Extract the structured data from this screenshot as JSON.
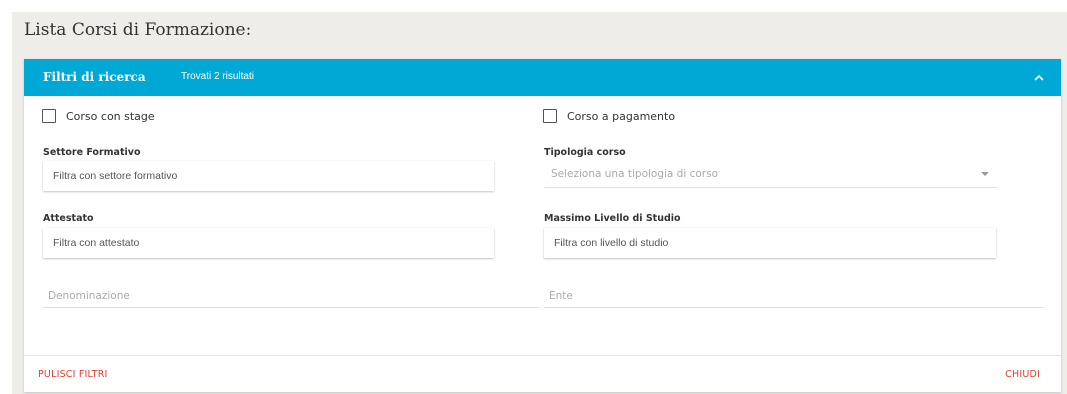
{
  "page": {
    "title": "Lista Corsi di Formazione:"
  },
  "panel": {
    "title": "Filtri di ricerca",
    "results": "Trovati 2 risultati",
    "collapse_icon": "chevron-up-icon",
    "colors": {
      "header_bg": "#00a8d6",
      "action": "#e03e2d"
    }
  },
  "filters": {
    "stage_checkbox": {
      "label": "Corso con stage",
      "checked": false
    },
    "payment_checkbox": {
      "label": "Corso a pagamento",
      "checked": false
    },
    "settore": {
      "label": "Settore Formativo",
      "placeholder": "Filtra con settore formativo",
      "value": ""
    },
    "tipologia": {
      "label": "Tipologia corso",
      "placeholder": "Seleziona una tipologia di corso"
    },
    "attestato": {
      "label": "Attestato",
      "placeholder": "Filtra con attestato",
      "value": ""
    },
    "livello": {
      "label": "Massimo Livello di Studio",
      "placeholder": "Filtra con livello di studio",
      "value": ""
    },
    "denominazione": {
      "placeholder": "Denominazione",
      "value": ""
    },
    "ente": {
      "placeholder": "Ente",
      "value": ""
    }
  },
  "actions": {
    "clear_label": "PULISCI FILTRI",
    "close_label": "CHIUDI"
  }
}
